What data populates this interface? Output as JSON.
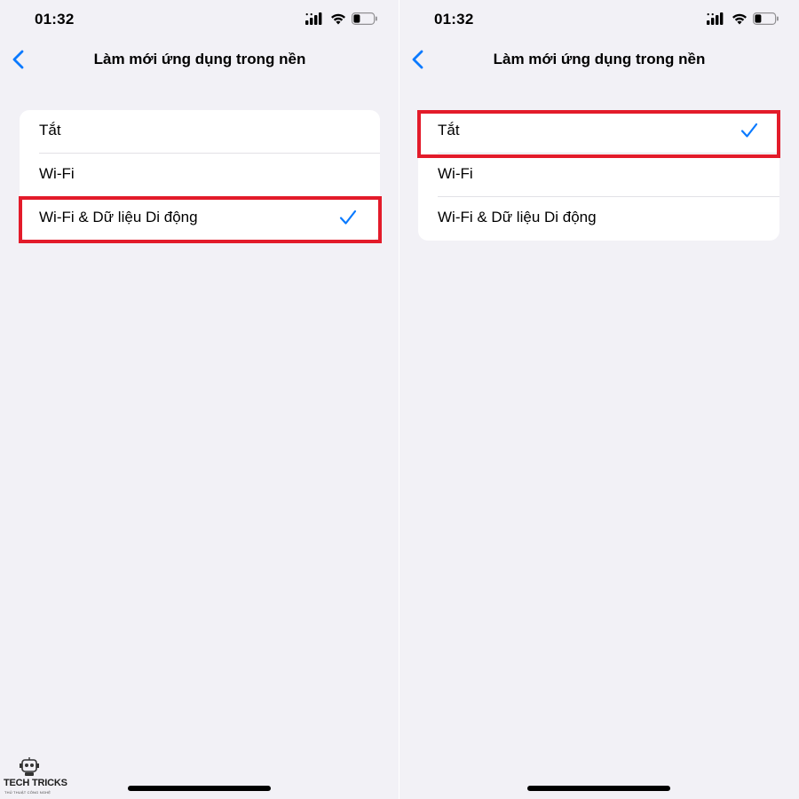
{
  "screens": [
    {
      "status": {
        "time": "01:32"
      },
      "nav": {
        "title": "Làm mới ứng dụng trong nền",
        "back_icon": "chevron-left-icon"
      },
      "options": [
        {
          "label": "Tắt",
          "selected": false
        },
        {
          "label": "Wi-Fi",
          "selected": false
        },
        {
          "label": "Wi-Fi & Dữ liệu Di động",
          "selected": true
        }
      ]
    },
    {
      "status": {
        "time": "01:32"
      },
      "nav": {
        "title": "Làm mới ứng dụng trong nền",
        "back_icon": "chevron-left-icon"
      },
      "options": [
        {
          "label": "Tắt",
          "selected": true
        },
        {
          "label": "Wi-Fi",
          "selected": false
        },
        {
          "label": "Wi-Fi & Dữ liệu Di động",
          "selected": false
        }
      ]
    }
  ],
  "watermark": {
    "title": "TECH TRICKS",
    "subtitle": "THỦ THUẬT CÔNG NGHỆ"
  },
  "colors": {
    "accent": "#0a7aff",
    "highlight": "#e31b2a",
    "background": "#f2f1f6",
    "card": "#ffffff"
  }
}
